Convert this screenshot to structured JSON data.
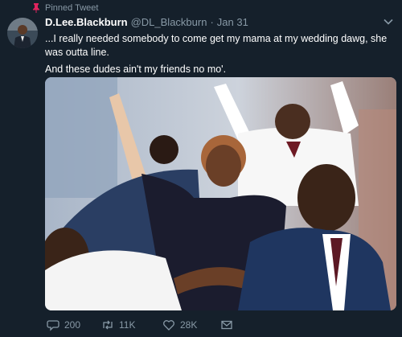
{
  "pinned_label": "Pinned Tweet",
  "tweet": {
    "display_name": "D.Lee.Blackburn",
    "handle": "@DL_Blackburn",
    "separator": "·",
    "date": "Jan 31",
    "text_line1": "...I really needed somebody to come get my mama at my wedding dawg, she was outta line.",
    "text_line2": "And these dudes ain't my friends no mo'."
  },
  "actions": {
    "replies": "200",
    "retweets": "11K",
    "likes": "28K"
  },
  "colors": {
    "background": "#15202b",
    "secondary_text": "#8899a6",
    "pin": "#e0245e"
  },
  "icons": [
    "pin-icon",
    "chevron-down-icon",
    "reply-icon",
    "retweet-icon",
    "like-icon",
    "message-icon"
  ]
}
